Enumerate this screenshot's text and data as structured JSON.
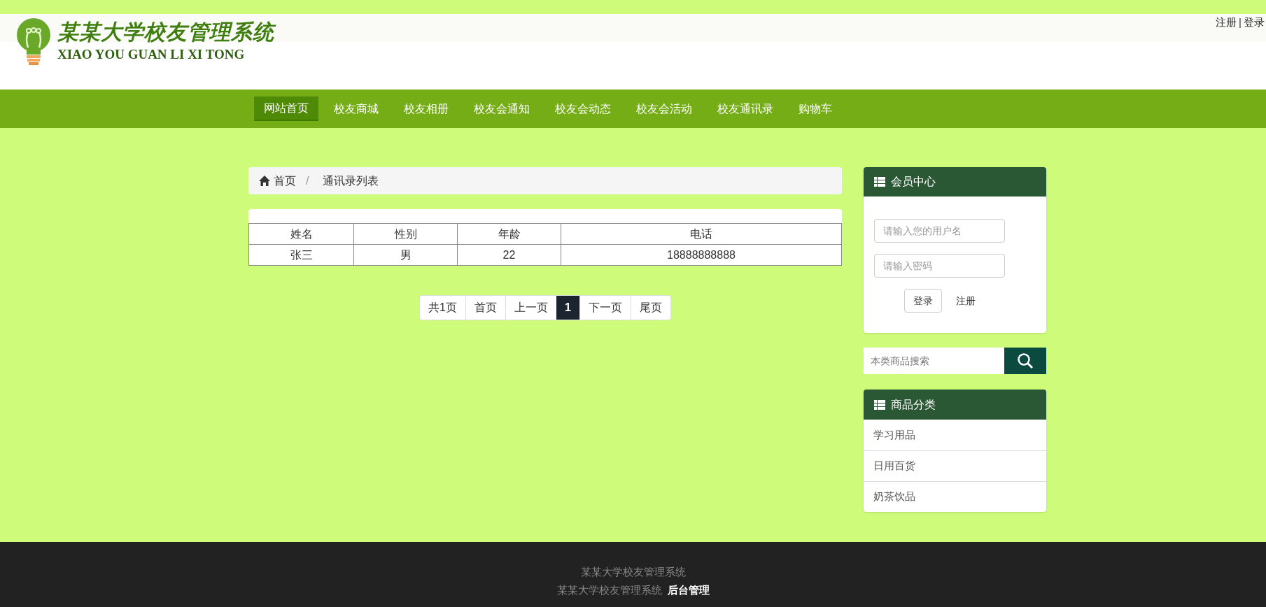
{
  "header": {
    "logo_title": "某某大学校友管理系统",
    "logo_subtitle": "XIAO YOU GUAN LI XI TONG",
    "top_links": [
      "注册",
      "登录"
    ],
    "top_separator": "|"
  },
  "nav": [
    {
      "label": "网站首页",
      "selected": true
    },
    {
      "label": "校友商城",
      "selected": false
    },
    {
      "label": "校友相册",
      "selected": false
    },
    {
      "label": "校友会通知",
      "selected": false
    },
    {
      "label": "校友会动态",
      "selected": false
    },
    {
      "label": "校友会活动",
      "selected": false
    },
    {
      "label": "校友通讯录",
      "selected": false
    },
    {
      "label": "购物车",
      "selected": false
    }
  ],
  "breadcrumb": {
    "items": [
      "首页",
      "通讯录列表"
    ],
    "separator": "/"
  },
  "table": {
    "columns": [
      "姓名",
      "性别",
      "年龄",
      "电话"
    ],
    "rows": [
      [
        "张三",
        "男",
        "22",
        "18888888888"
      ]
    ]
  },
  "pagination": [
    {
      "label": "共1页",
      "selected": false
    },
    {
      "label": "首页",
      "selected": false
    },
    {
      "label": "上一页",
      "selected": false
    },
    {
      "label": "1",
      "selected": true
    },
    {
      "label": "下一页",
      "selected": false
    },
    {
      "label": "尾页",
      "selected": false
    }
  ],
  "member_panel": {
    "title": "会员中心",
    "username_placeholder": "请输入您的用户名",
    "password_placeholder": "请输入密码",
    "login_button": "登录",
    "register_link": "注册"
  },
  "search": {
    "placeholder": "本类商品搜索"
  },
  "category_panel": {
    "title": "商品分类",
    "items": [
      "学习用品",
      "日用百货",
      "奶茶饮品"
    ]
  },
  "footer": {
    "line1": "某某大学校友管理系统",
    "line2": "某某大学校友管理系统",
    "admin_link": "后台管理"
  }
}
